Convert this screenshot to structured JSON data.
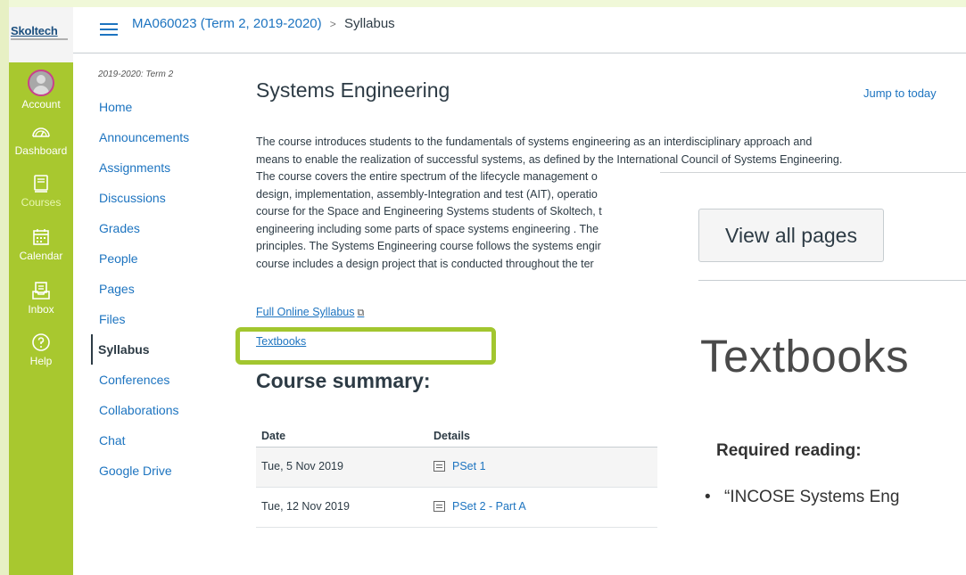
{
  "logo": {
    "text": "Skoltech"
  },
  "global_nav": [
    {
      "label": "Account",
      "icon": "avatar-icon"
    },
    {
      "label": "Dashboard",
      "icon": "dashboard-icon"
    },
    {
      "label": "Courses",
      "icon": "book-icon",
      "active": true
    },
    {
      "label": "Calendar",
      "icon": "calendar-icon"
    },
    {
      "label": "Inbox",
      "icon": "inbox-icon"
    },
    {
      "label": "Help",
      "icon": "help-icon"
    }
  ],
  "header": {
    "course": "MA060023 (Term 2, 2019-2020)",
    "separator": ">",
    "current": "Syllabus"
  },
  "course_nav": {
    "term": "2019-2020: Term 2",
    "items": [
      "Home",
      "Announcements",
      "Assignments",
      "Discussions",
      "Grades",
      "People",
      "Pages",
      "Files",
      "Syllabus",
      "Conferences",
      "Collaborations",
      "Chat",
      "Google Drive"
    ],
    "active": "Syllabus"
  },
  "main": {
    "title": "Systems Engineering",
    "jump_to_today": "Jump to today",
    "description_lines": [
      "The course introduces students to the fundamentals of systems engineering as an interdisciplinary approach and",
      "means to enable the realization of successful systems, as defined by the International Council of Systems Engineering.",
      "The course covers the entire spectrum of the lifecycle management o",
      "design, implementation, assembly-Integration and test (AIT), operatio",
      "course for the Space and Engineering Systems students of Skoltech, t",
      "engineering including some parts of space systems engineering . The",
      "principles. The Systems Engineering course follows the systems engir",
      "course includes a design project that is conducted throughout the ter"
    ],
    "full_syllabus_link": "Full Online Syllabus",
    "textbooks_link": "Textbooks",
    "summary_title": "Course summary:",
    "table": {
      "headers": [
        "Date",
        "Details"
      ],
      "rows": [
        {
          "date": "Tue, 5 Nov 2019",
          "detail": "PSet 1"
        },
        {
          "date": "Tue, 12 Nov 2019",
          "detail": "PSet 2 - Part A"
        }
      ]
    }
  },
  "overlay": {
    "view_all_pages": "View all pages",
    "heading": "Textbooks",
    "required_reading": "Required reading:",
    "bullet": "“INCOSE Systems Eng"
  },
  "colors": {
    "nav_green": "#a8c82f",
    "link_blue": "#1d74c0",
    "highlight": "#a2c62f"
  }
}
